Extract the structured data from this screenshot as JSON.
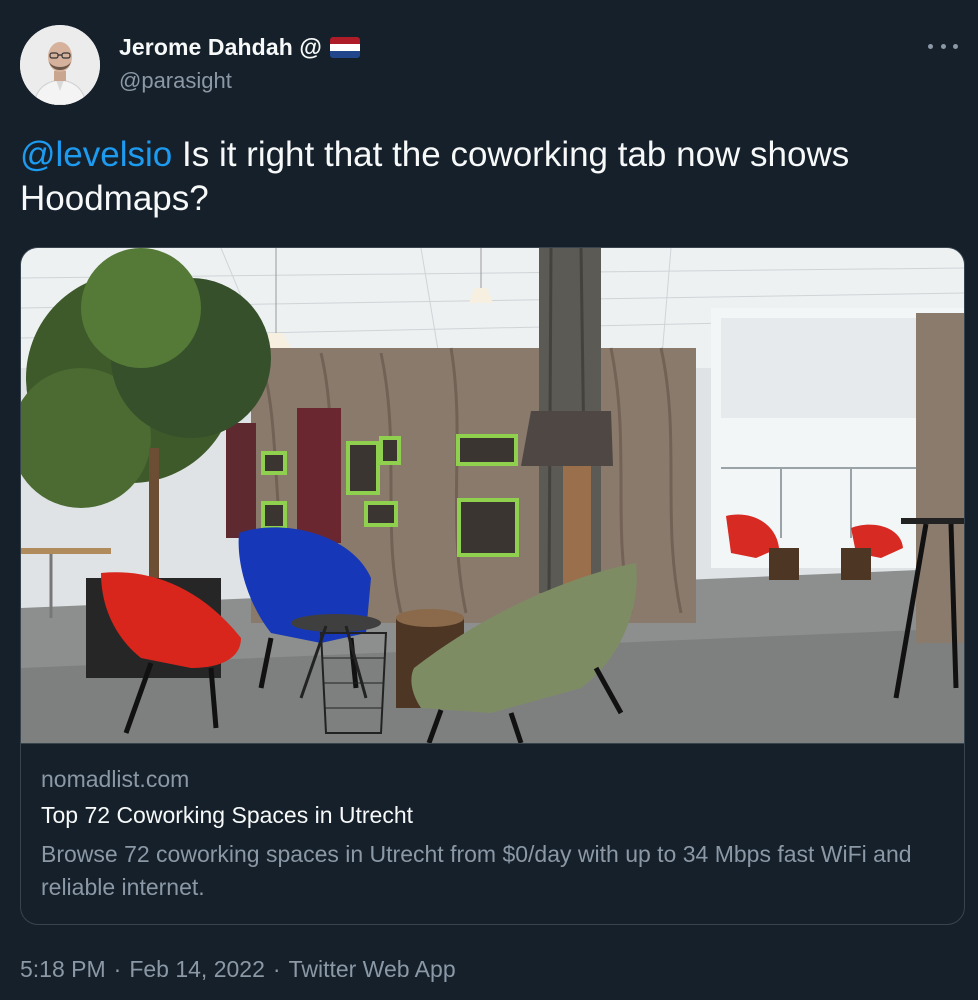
{
  "author": {
    "display_name": "Jerome Dahdah @",
    "handle": "@parasight",
    "flag_colors": [
      "#ae1c28",
      "#ffffff",
      "#21468b"
    ]
  },
  "more_icon": "more-horizontal-icon",
  "tweet": {
    "mention": "@levelsio",
    "text": " Is it right that the coworking tab now shows Hoodmaps?"
  },
  "card": {
    "domain": "nomadlist.com",
    "title": "Top 72 Coworking Spaces in Utrecht",
    "description": "Browse 72 coworking spaces in Utrecht from $0/day with up to 34 Mbps fast WiFi and reliable internet."
  },
  "meta": {
    "time": "5:18 PM",
    "sep1": "·",
    "date": "Feb 14, 2022",
    "sep2": "·",
    "source": "Twitter Web App"
  },
  "colors": {
    "background": "#15202b",
    "link": "#1d9bf0",
    "secondary_text": "#8b98a5",
    "border": "#38444d"
  }
}
